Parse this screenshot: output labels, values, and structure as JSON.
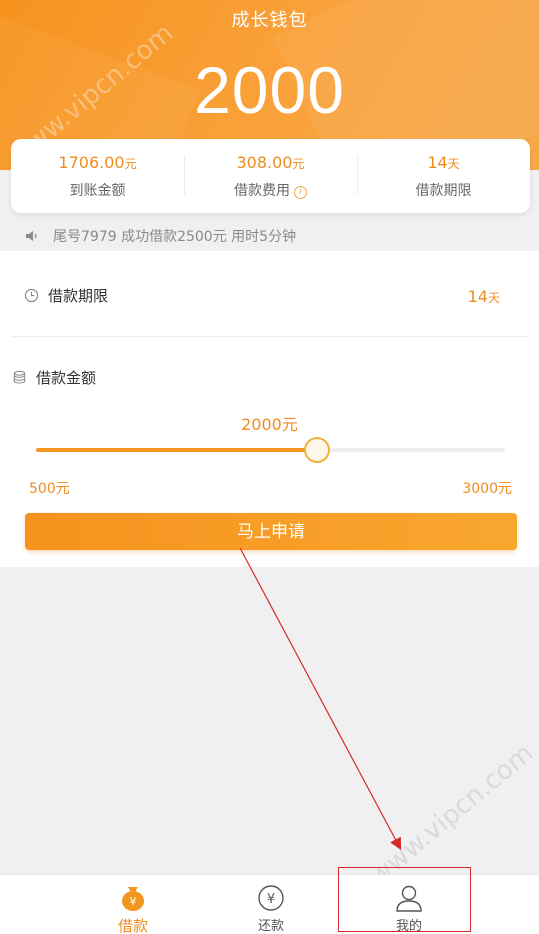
{
  "header": {
    "title": "成长钱包",
    "amount": "2000"
  },
  "summary": {
    "received": {
      "value": "1706.00",
      "unit": "元",
      "label": "到账金额"
    },
    "fee": {
      "value": "308.00",
      "unit": "元",
      "label": "借款费用"
    },
    "term": {
      "value": "14",
      "unit": "天",
      "label": "借款期限"
    }
  },
  "notice": {
    "text": "尾号7979 成功借款2500元 用时5分钟"
  },
  "term_row": {
    "label": "借款期限",
    "value": "14",
    "unit": "天"
  },
  "amount_row": {
    "label": "借款金额",
    "current": "2000元",
    "min_label": "500元",
    "max_label": "3000元",
    "slider": {
      "min": 500,
      "max": 3000,
      "value": 2000
    }
  },
  "apply_button": "马上申请",
  "watermark": "www.vipcn.com",
  "tabs": [
    {
      "label": "借款",
      "icon": "money-bag-icon",
      "active": true
    },
    {
      "label": "还款",
      "icon": "yen-circle-icon",
      "active": false
    },
    {
      "label": "我的",
      "icon": "user-icon",
      "active": false
    }
  ],
  "colors": {
    "brand": "#f7931e",
    "accent_text": "#f08c1e",
    "annotation": "#d42a2a"
  }
}
